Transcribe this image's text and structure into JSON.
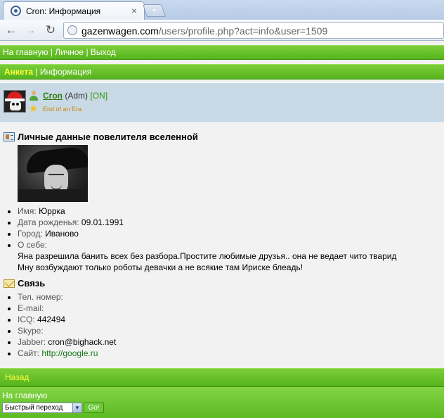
{
  "browser": {
    "tab_title": "Cron: Информация",
    "tab_close": "×",
    "new_tab": "+",
    "url_host": "gazenwagen.com",
    "url_path": "/users/profile.php?act=info&user=1509"
  },
  "topnav": {
    "home": "На главную",
    "sep": "|",
    "personal": "Личное",
    "logout": "Выход"
  },
  "tabs": {
    "active": "Анкета",
    "sep": "|",
    "info": "Информация"
  },
  "user": {
    "name": "Cron",
    "role": "(Adm)",
    "status": "[ON]",
    "title": "End of an Era"
  },
  "personal": {
    "heading": "Личные данные повелителя вселенной",
    "items": [
      {
        "label": "Имя:",
        "value": "Юррка"
      },
      {
        "label": "Дата рожденья:",
        "value": "09.01.1991"
      },
      {
        "label": "Город:",
        "value": "Иваново"
      },
      {
        "label": "О себе:",
        "value": ""
      }
    ],
    "about_lines": [
      "Яна разрешила банить всех без разбора.Простите любимые друзья.. она не ведает чито тварид",
      "Мну возбуждают только роботы девачки а не всякие там Ириске блеадь!"
    ]
  },
  "contact": {
    "heading": "Связь",
    "items": [
      {
        "label": "Тел. номер:",
        "value": ""
      },
      {
        "label": "E-mail:",
        "value": ""
      },
      {
        "label": "ICQ:",
        "value": "442494"
      },
      {
        "label": "Skype:",
        "value": ""
      },
      {
        "label": "Jabber:",
        "value": "cron@bighack.net"
      },
      {
        "label": "Сайт:",
        "value": "http://google.ru"
      }
    ]
  },
  "footer": {
    "back": "Назад",
    "home": "На главную",
    "quick_jump": "Быстрый переход",
    "go": "Go!"
  }
}
